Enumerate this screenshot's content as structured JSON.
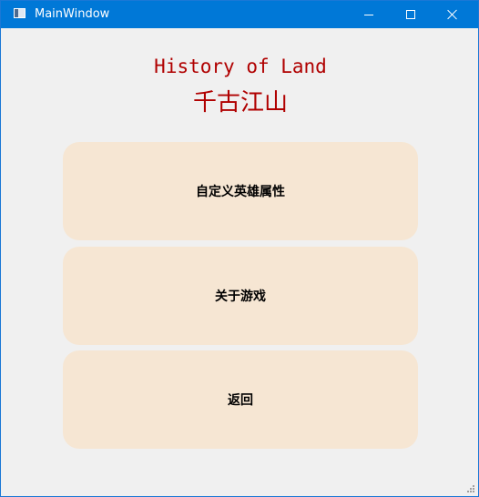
{
  "window": {
    "title": "MainWindow"
  },
  "content": {
    "title_en": "History of Land",
    "title_zh": "千古江山"
  },
  "menu": {
    "buttons": [
      {
        "label": "自定义英雄属性"
      },
      {
        "label": "关于游戏"
      },
      {
        "label": "返回"
      }
    ]
  },
  "colors": {
    "titlebar": "#0078d7",
    "heading": "#b00000",
    "button_bg": "#f6e6d3",
    "window_bg": "#f0f0f0"
  },
  "icons": [
    "app-icon",
    "minimize-icon",
    "maximize-icon",
    "close-icon",
    "resize-grip-icon"
  ]
}
